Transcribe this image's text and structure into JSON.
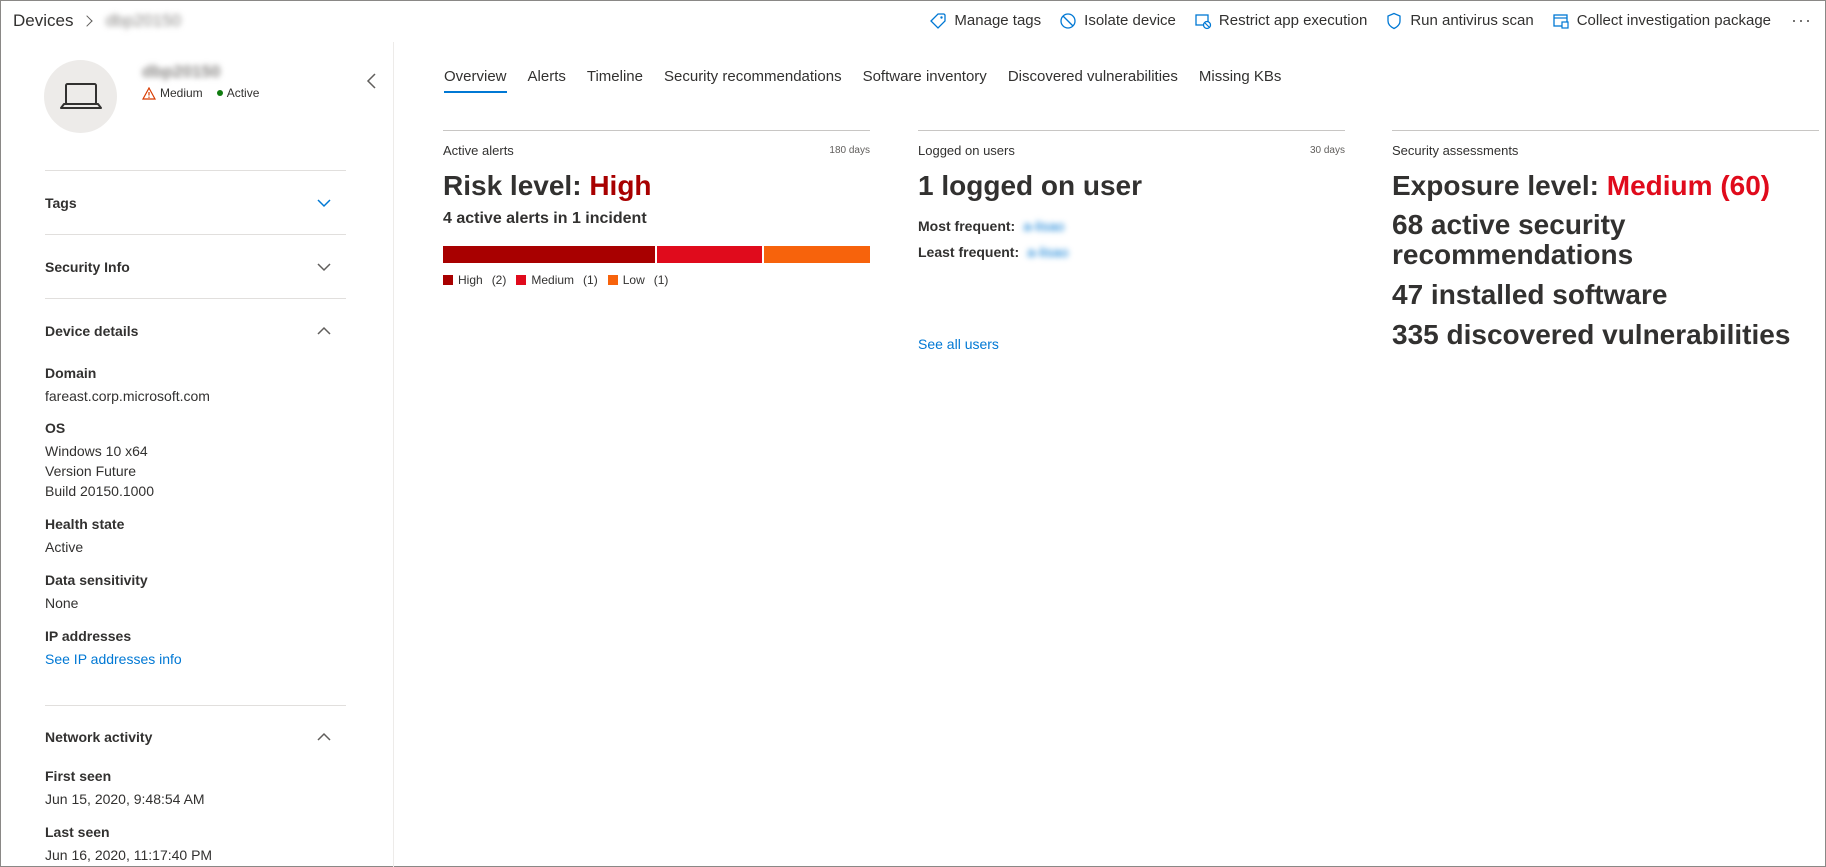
{
  "breadcrumb": {
    "root": "Devices",
    "device": "dbp20150"
  },
  "actions": {
    "manage_tags": "Manage tags",
    "isolate": "Isolate device",
    "restrict": "Restrict app execution",
    "antivirus": "Run antivirus scan",
    "collect": "Collect investigation package",
    "more": "···"
  },
  "device": {
    "name": "dbp20150",
    "risk": "Medium",
    "health": "Active",
    "icon": "laptop-icon"
  },
  "sections": {
    "tags": "Tags",
    "security_info": "Security Info",
    "device_details": "Device details",
    "network_activity": "Network activity"
  },
  "details": {
    "domain_label": "Domain",
    "domain": "fareast.corp.microsoft.com",
    "os_label": "OS",
    "os_line1": "Windows 10 x64",
    "os_line2": "Version Future",
    "os_line3": "Build 20150.1000",
    "health_label": "Health state",
    "health": "Active",
    "sensitivity_label": "Data sensitivity",
    "sensitivity": "None",
    "ip_label": "IP addresses",
    "ip_link": "See IP addresses info"
  },
  "network": {
    "first_seen_label": "First seen",
    "first_seen": "Jun 15, 2020, 9:48:54 AM",
    "last_seen_label": "Last seen",
    "last_seen": "Jun 16, 2020, 11:17:40 PM"
  },
  "tabs": [
    "Overview",
    "Alerts",
    "Timeline",
    "Security recommendations",
    "Software inventory",
    "Discovered vulnerabilities",
    "Missing KBs"
  ],
  "alerts_card": {
    "title": "Active alerts",
    "days": "180 days",
    "risk_prefix": "Risk level: ",
    "risk_value": "High",
    "summary": "4 active alerts in 1 incident",
    "legend": [
      {
        "label": "High",
        "count": "(2)",
        "value": 2,
        "color": "#a80000"
      },
      {
        "label": "Medium",
        "count": "(1)",
        "value": 1,
        "color": "#e00b1c"
      },
      {
        "label": "Low",
        "count": "(1)",
        "value": 1,
        "color": "#f7630c"
      }
    ]
  },
  "users_card": {
    "title": "Logged on users",
    "days": "30 days",
    "headline": "1 logged on user",
    "most_label": "Most frequent:",
    "most_value": "a-lisao",
    "least_label": "Least frequent:",
    "least_value": "a-lisao",
    "see_all": "See all users"
  },
  "assess_card": {
    "title": "Security assessments",
    "exposure_prefix": "Exposure level: ",
    "exposure_value": "Medium (60)",
    "recommendations": "68 active security recommendations",
    "software": "47 installed software",
    "vulnerabilities": "335 discovered vulnerabilities"
  },
  "colors": {
    "accent": "#0078d4",
    "high": "#a80000",
    "medium_red": "#e00b1c",
    "warning": "#d83b01"
  }
}
